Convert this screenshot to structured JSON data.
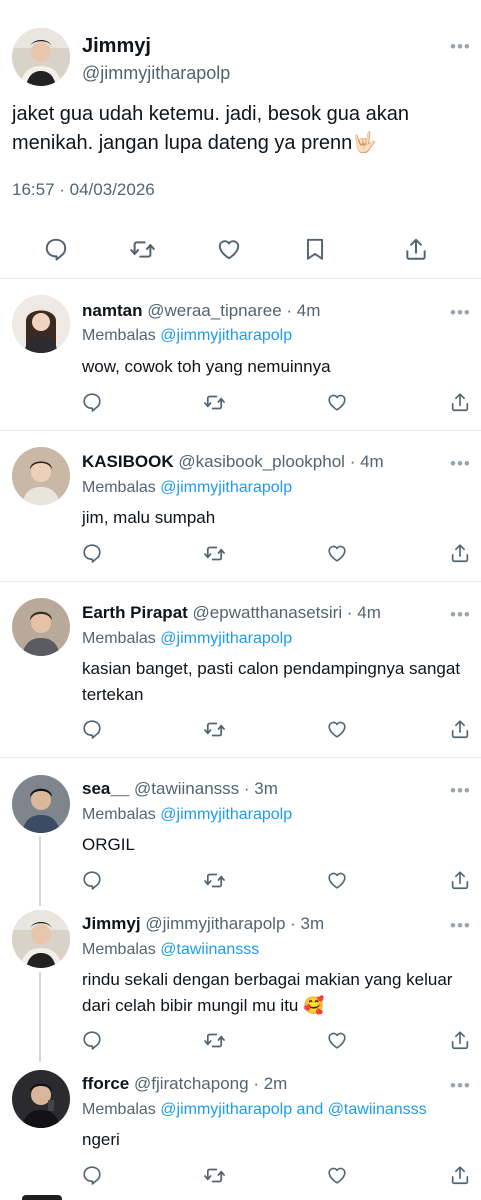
{
  "main_tweet": {
    "author_name": "Jimmyj",
    "author_handle": "@jimmyjitharapolp",
    "text": "jaket gua udah ketemu. jadi, besok gua akan menikah. jangan lupa dateng ya prenn🤟🏻",
    "timestamp": "16:57 · 04/03/2026",
    "actions": [
      "reply-icon",
      "retweet-icon",
      "like-icon",
      "bookmark-icon",
      "share-icon"
    ]
  },
  "replies": [
    {
      "name": "namtan",
      "handle": "@weraa_tipnaree",
      "time": "4m",
      "reply_prefix": "Membalas",
      "reply_to": "@jimmyjitharapolp",
      "text": "wow, cowok toh yang nemuinnya"
    },
    {
      "name": "KASIBOOK",
      "handle": "@kasibook_plookphol",
      "time": "4m",
      "reply_prefix": "Membalas",
      "reply_to": "@jimmyjitharapolp",
      "text": "jim, malu sumpah"
    },
    {
      "name": "Earth Pirapat",
      "handle": "@epwatthanasetsiri",
      "time": "4m",
      "reply_prefix": "Membalas",
      "reply_to": "@jimmyjitharapolp",
      "text": "kasian banget, pasti calon pendampingnya sangat tertekan"
    },
    {
      "name": "sea__",
      "handle": "@tawiinansss",
      "time": "3m",
      "reply_prefix": "Membalas",
      "reply_to": "@jimmyjitharapolp",
      "text": "ORGIL"
    },
    {
      "name": "Jimmyj",
      "handle": "@jimmyjitharapolp",
      "time": "3m",
      "reply_prefix": "Membalas",
      "reply_to": "@tawiinansss",
      "text": "rindu sekali dengan berbagai makian yang keluar dari celah bibir mungil mu itu 🥰"
    },
    {
      "name": "fforce",
      "handle": "@fjiratchapong",
      "time": "2m",
      "reply_prefix": "Membalas",
      "reply_to": "@jimmyjitharapolp and @tawiinansss",
      "text": "ngeri"
    }
  ],
  "separator": "·",
  "more_glyph": "•••"
}
